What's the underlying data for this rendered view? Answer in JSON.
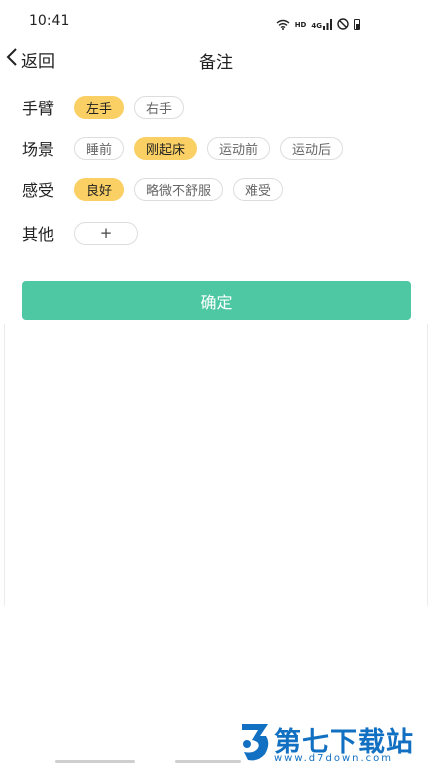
{
  "status_bar": {
    "time": "10:41",
    "hd_label": "HD",
    "signal_label": "4G",
    "icons": [
      "wifi-icon",
      "hd-label",
      "signal-4g-icon",
      "do-not-disturb-icon",
      "battery-icon"
    ]
  },
  "header": {
    "back_label": "返回",
    "title": "备注",
    "back_icon": "chevron-left-icon"
  },
  "rows": [
    {
      "label": "手臂",
      "options": [
        {
          "text": "左手",
          "selected": true
        },
        {
          "text": "右手",
          "selected": false
        }
      ]
    },
    {
      "label": "场景",
      "options": [
        {
          "text": "睡前",
          "selected": false
        },
        {
          "text": "刚起床",
          "selected": true
        },
        {
          "text": "运动前",
          "selected": false
        },
        {
          "text": "运动后",
          "selected": false
        }
      ]
    },
    {
      "label": "感受",
      "options": [
        {
          "text": "良好",
          "selected": true
        },
        {
          "text": "略微不舒服",
          "selected": false
        },
        {
          "text": "难受",
          "selected": false
        }
      ]
    },
    {
      "label": "其他",
      "add_label": "+"
    }
  ],
  "confirm_label": "确定",
  "watermark": {
    "brand": "第七下载站",
    "url": "www.d7down.com"
  },
  "colors": {
    "selected_chip": "#fad064",
    "confirm_button": "#4ec7a3",
    "watermark": "#1170c2",
    "chip_border": "#dddddd"
  }
}
